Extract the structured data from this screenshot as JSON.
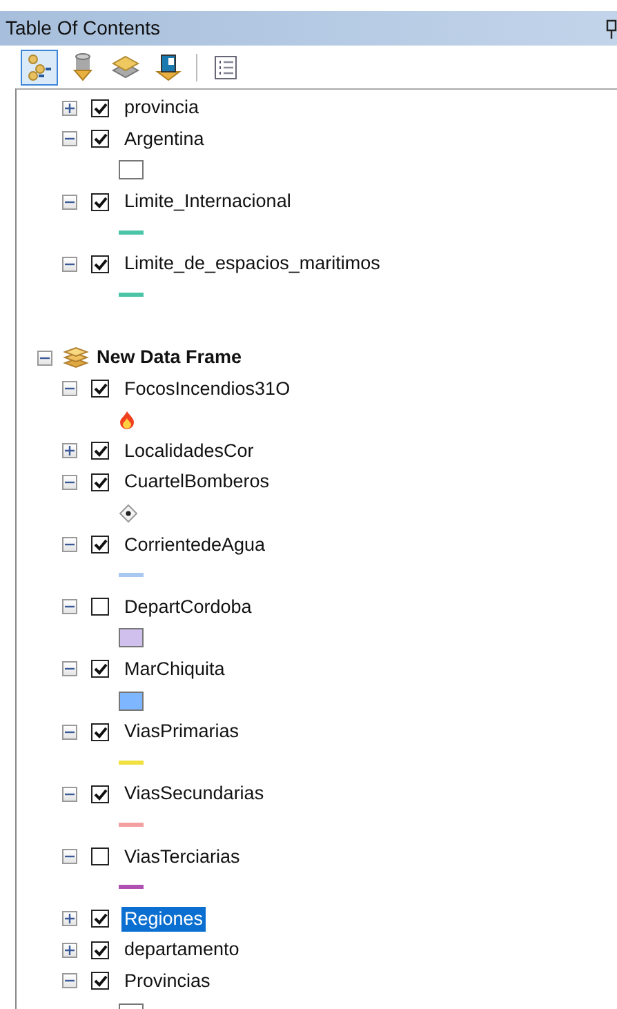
{
  "panel": {
    "title": "Table Of Contents"
  },
  "toolbar": [
    {
      "kind": "tree",
      "selected": true
    },
    {
      "kind": "source",
      "selected": false
    },
    {
      "kind": "visibility",
      "selected": false
    },
    {
      "kind": "selection",
      "selected": false
    },
    {
      "kind": "options",
      "selected": false
    }
  ],
  "tree": [
    {
      "kind": "layer",
      "name": "provincia",
      "checked": true,
      "expanded": false,
      "selected": false
    },
    {
      "kind": "layer",
      "name": "Argentina",
      "checked": true,
      "expanded": true,
      "selected": false,
      "symbol": {
        "kind": "fill",
        "color": "#ffffff"
      }
    },
    {
      "kind": "layer",
      "name": "Limite_Internacional",
      "checked": true,
      "expanded": true,
      "selected": false,
      "symbol": {
        "kind": "line",
        "color": "#4cc4a8"
      }
    },
    {
      "kind": "layer",
      "name": "Limite_de_espacios_maritimos",
      "checked": true,
      "expanded": true,
      "selected": false,
      "symbol": {
        "kind": "line",
        "color": "#4cc4a8"
      }
    },
    {
      "kind": "frame",
      "name": "New Data Frame",
      "expanded": true,
      "children": [
        {
          "kind": "layer",
          "name": "FocosIncendios31O",
          "checked": true,
          "expanded": true,
          "selected": false,
          "symbol": {
            "kind": "fire"
          }
        },
        {
          "kind": "layer",
          "name": "LocalidadesCor",
          "checked": true,
          "expanded": false,
          "selected": false
        },
        {
          "kind": "layer",
          "name": "CuartelBomberos",
          "checked": true,
          "expanded": true,
          "selected": false,
          "symbol": {
            "kind": "marker"
          }
        },
        {
          "kind": "layer",
          "name": "CorrientedeAgua",
          "checked": true,
          "expanded": true,
          "selected": false,
          "symbol": {
            "kind": "line",
            "color": "#a8c8f0"
          }
        },
        {
          "kind": "layer",
          "name": "DepartCordoba",
          "checked": false,
          "expanded": true,
          "selected": false,
          "symbol": {
            "kind": "fill",
            "color": "#cfc0ee"
          }
        },
        {
          "kind": "layer",
          "name": "MarChiquita",
          "checked": true,
          "expanded": true,
          "selected": false,
          "symbol": {
            "kind": "fill",
            "color": "#7eb6ff"
          }
        },
        {
          "kind": "layer",
          "name": "ViasPrimarias",
          "checked": true,
          "expanded": true,
          "selected": false,
          "symbol": {
            "kind": "line",
            "color": "#f0e040"
          }
        },
        {
          "kind": "layer",
          "name": "ViasSecundarias",
          "checked": true,
          "expanded": true,
          "selected": false,
          "symbol": {
            "kind": "line",
            "color": "#f4a0a0"
          }
        },
        {
          "kind": "layer",
          "name": "ViasTerciarias",
          "checked": false,
          "expanded": true,
          "selected": false,
          "symbol": {
            "kind": "line",
            "color": "#b050b0"
          }
        },
        {
          "kind": "layer",
          "name": "Regiones",
          "checked": true,
          "expanded": false,
          "selected": true
        },
        {
          "kind": "layer",
          "name": "departamento",
          "checked": true,
          "expanded": false,
          "selected": false
        },
        {
          "kind": "layer",
          "name": "Provincias",
          "checked": true,
          "expanded": true,
          "selected": false,
          "symbol": {
            "kind": "fill",
            "color": "#ffffff"
          }
        }
      ]
    }
  ]
}
